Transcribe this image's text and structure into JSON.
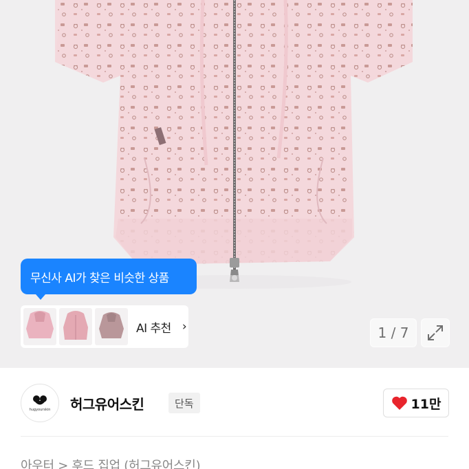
{
  "gallery": {
    "tooltip_text": "무신사 AI가 찾은 비슷한 상품",
    "ai_recommend_label": "AI 추천",
    "ai_recommend_chevron": "›",
    "pager_text": "1 / 7",
    "expand_icon": "expand-icon"
  },
  "brand": {
    "name": "허그유어스킨",
    "logo_text": "hugyourskin",
    "exclusive_badge": "단독",
    "like_count": "11만"
  },
  "breadcrumb": "아우터 > 후드 집업 (허그유어스킨)",
  "colors": {
    "accent_blue": "#1a84ff",
    "heart_red": "#e8242c",
    "garment_pink": "#f3d6da"
  }
}
